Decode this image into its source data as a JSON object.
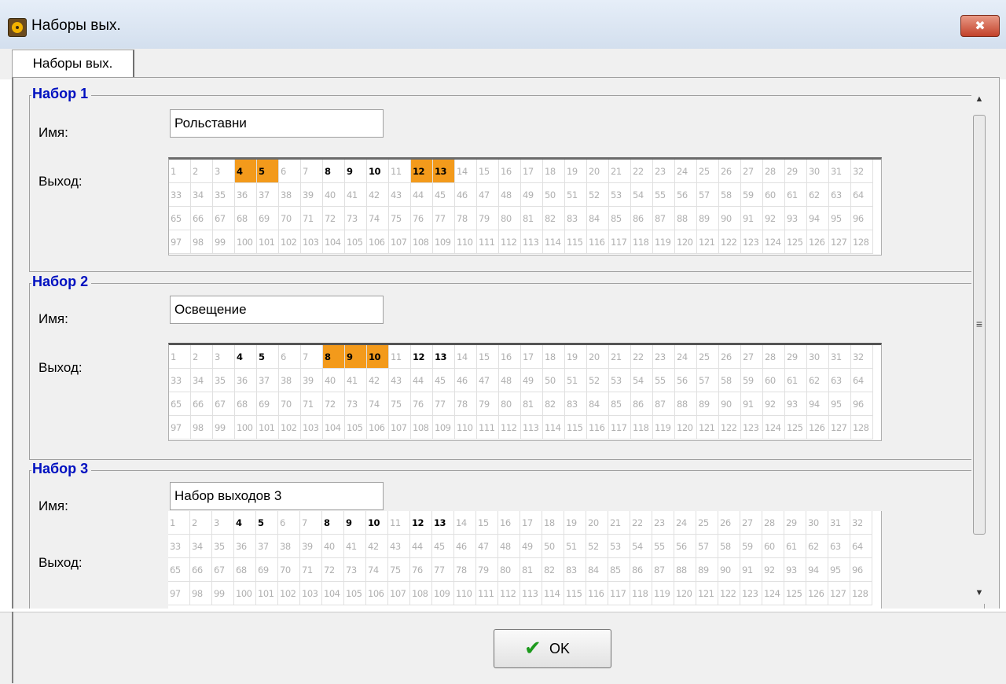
{
  "window": {
    "title": "Наборы вых.",
    "close_icon": "✖"
  },
  "tabs": [
    {
      "label": "Наборы вых."
    }
  ],
  "labels": {
    "name": "Имя:",
    "output": "Выход:"
  },
  "colors": {
    "selected": "#f39a1b",
    "group_title": "#0010c0",
    "active_text": "#000000",
    "inactive_text": "#b0b0b0"
  },
  "groups": [
    {
      "title": "Набор 1",
      "name": "Рольставни",
      "selected": [
        4,
        5,
        12,
        13
      ],
      "active": [
        8,
        9,
        10
      ]
    },
    {
      "title": "Набор 2",
      "name": "Освещение",
      "selected": [
        8,
        9,
        10
      ],
      "active": [
        4,
        5,
        12,
        13
      ]
    },
    {
      "title": "Набор 3",
      "name": "Набор выходов 3",
      "selected": [],
      "active": [
        4,
        5,
        8,
        9,
        10,
        12,
        13
      ]
    }
  ],
  "scrollbar": {
    "up": "▲",
    "down": "▼",
    "grip": "≡"
  },
  "footer": {
    "ok_label": "OK",
    "ok_icon": "✔"
  }
}
